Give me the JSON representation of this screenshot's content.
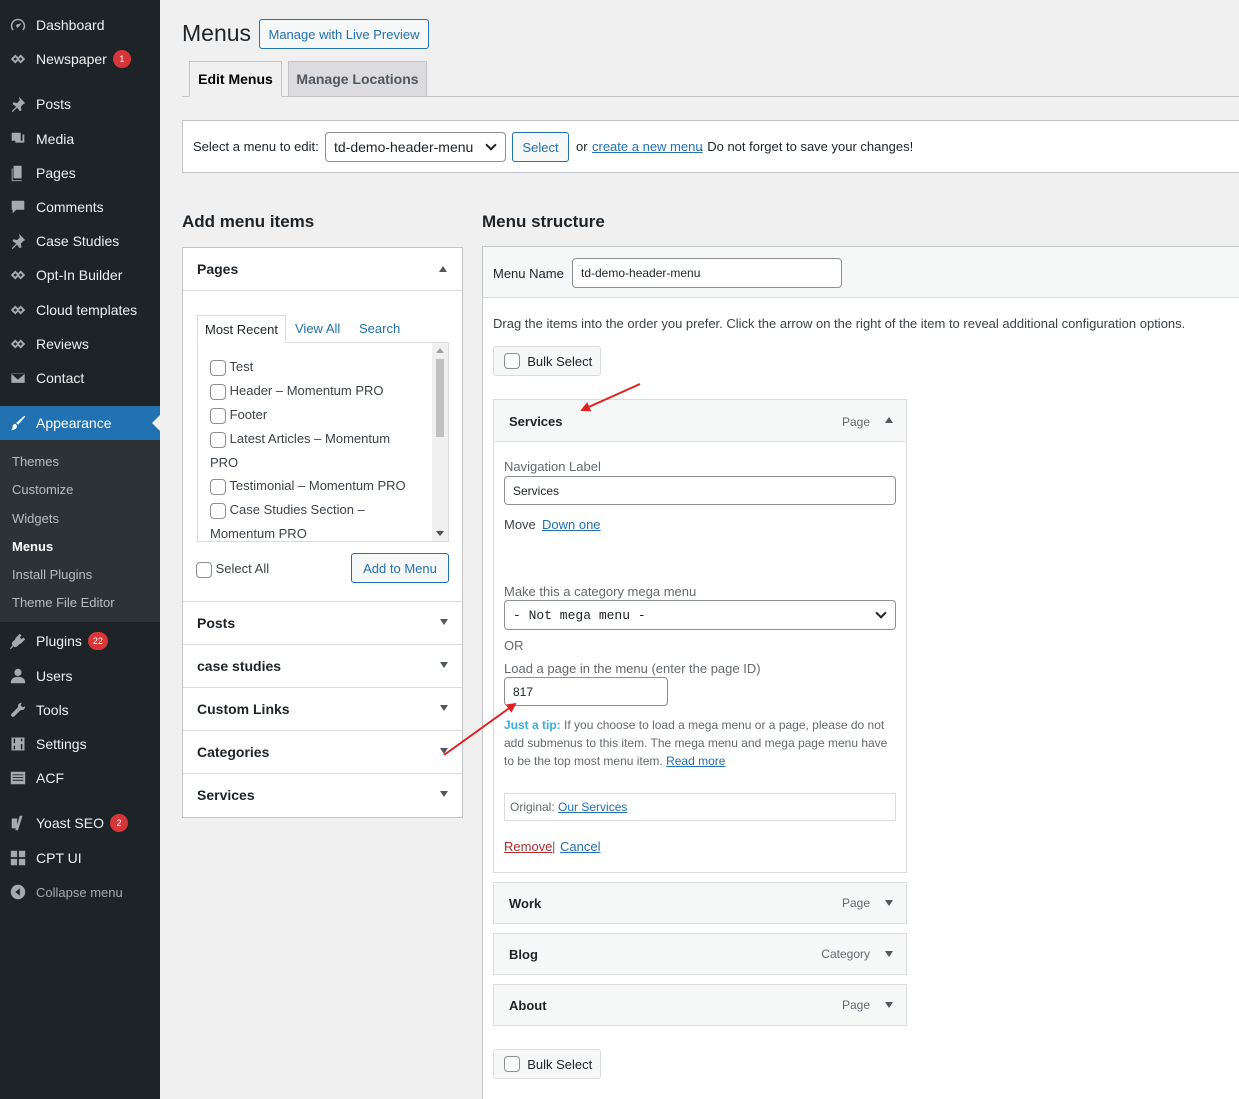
{
  "sidebar": {
    "items": [
      {
        "label": "Dashboard",
        "icon": "dashboard-icon"
      },
      {
        "label": "Newspaper",
        "icon": "newspaper-icon",
        "badge": "1"
      },
      {
        "label": "Posts",
        "icon": "pin-icon"
      },
      {
        "label": "Media",
        "icon": "media-icon"
      },
      {
        "label": "Pages",
        "icon": "pages-icon"
      },
      {
        "label": "Comments",
        "icon": "comments-icon"
      },
      {
        "label": "Case Studies",
        "icon": "pin-icon"
      },
      {
        "label": "Opt-In Builder",
        "icon": "diamond-icon"
      },
      {
        "label": "Cloud templates",
        "icon": "diamond-icon"
      },
      {
        "label": "Reviews",
        "icon": "diamond-icon"
      },
      {
        "label": "Contact",
        "icon": "mail-icon"
      },
      {
        "label": "Appearance",
        "icon": "brush-icon"
      },
      {
        "label": "Plugins",
        "icon": "plug-icon",
        "badge": "22"
      },
      {
        "label": "Users",
        "icon": "user-icon"
      },
      {
        "label": "Tools",
        "icon": "wrench-icon"
      },
      {
        "label": "Settings",
        "icon": "settings-icon"
      },
      {
        "label": "ACF",
        "icon": "table-icon"
      },
      {
        "label": "Yoast SEO",
        "icon": "yoast-icon",
        "badge": "2"
      },
      {
        "label": "CPT UI",
        "icon": "grid-icon"
      },
      {
        "label": "Collapse menu",
        "icon": "collapse-icon"
      }
    ],
    "submenu": [
      "Themes",
      "Customize",
      "Widgets",
      "Menus",
      "Install Plugins",
      "Theme File Editor"
    ]
  },
  "header": {
    "title": "Menus",
    "live_preview": "Manage with Live Preview"
  },
  "tabs": [
    "Edit Menus",
    "Manage Locations"
  ],
  "select_bar": {
    "label": "Select a menu to edit:",
    "selected": "td-demo-header-menu",
    "select_button": "Select",
    "or": "or",
    "create_link": "create a new menu",
    "suffix": ". Do not forget to save your changes!"
  },
  "add_items": {
    "heading": "Add menu items",
    "pages_title": "Pages",
    "subtabs": [
      "Most Recent",
      "View All",
      "Search"
    ],
    "pages": [
      "Test",
      "Header – Momentum PRO",
      "Footer",
      "Latest Articles – Momentum",
      "PRO",
      "Testimonial – Momentum PRO",
      "Case Studies Section –",
      "Momentum PRO"
    ],
    "select_all": "Select All",
    "add_button": "Add to Menu",
    "sections": [
      "Posts",
      "case studies",
      "Custom Links",
      "Categories",
      "Services"
    ]
  },
  "structure": {
    "heading": "Menu structure",
    "menu_name_label": "Menu Name",
    "menu_name": "td-demo-header-menu",
    "instructions": "Drag the items into the order you prefer. Click the arrow on the right of the item to reveal additional configuration options.",
    "bulk_select": "Bulk Select",
    "expanded": {
      "title": "Services",
      "type": "Page",
      "nav_label_label": "Navigation Label",
      "nav_label": "Services",
      "move": "Move",
      "down_one": "Down one",
      "mega_label": "Make this a category mega menu",
      "mega_value": "- Not mega menu -",
      "or": "OR",
      "page_label": "Load a page in the menu (enter the page ID)",
      "page_id": "817",
      "tip_label": "Just a tip:",
      "tip_text": "If you choose to load a mega menu or a page, please do not add submenus to this item. The mega menu and mega page menu have to be the top most menu item.",
      "read_more": "Read more",
      "original_label": "Original:",
      "original_link": "Our Services",
      "remove": "Remove",
      "sep": "|",
      "cancel": "Cancel"
    },
    "items": [
      {
        "title": "Work",
        "type": "Page"
      },
      {
        "title": "Blog",
        "type": "Category"
      },
      {
        "title": "About",
        "type": "Page"
      }
    ]
  },
  "colors": {
    "sidebar": "#1d2327",
    "accent": "#2271b1",
    "badge": "#d63638",
    "annotation": "#e02020"
  }
}
